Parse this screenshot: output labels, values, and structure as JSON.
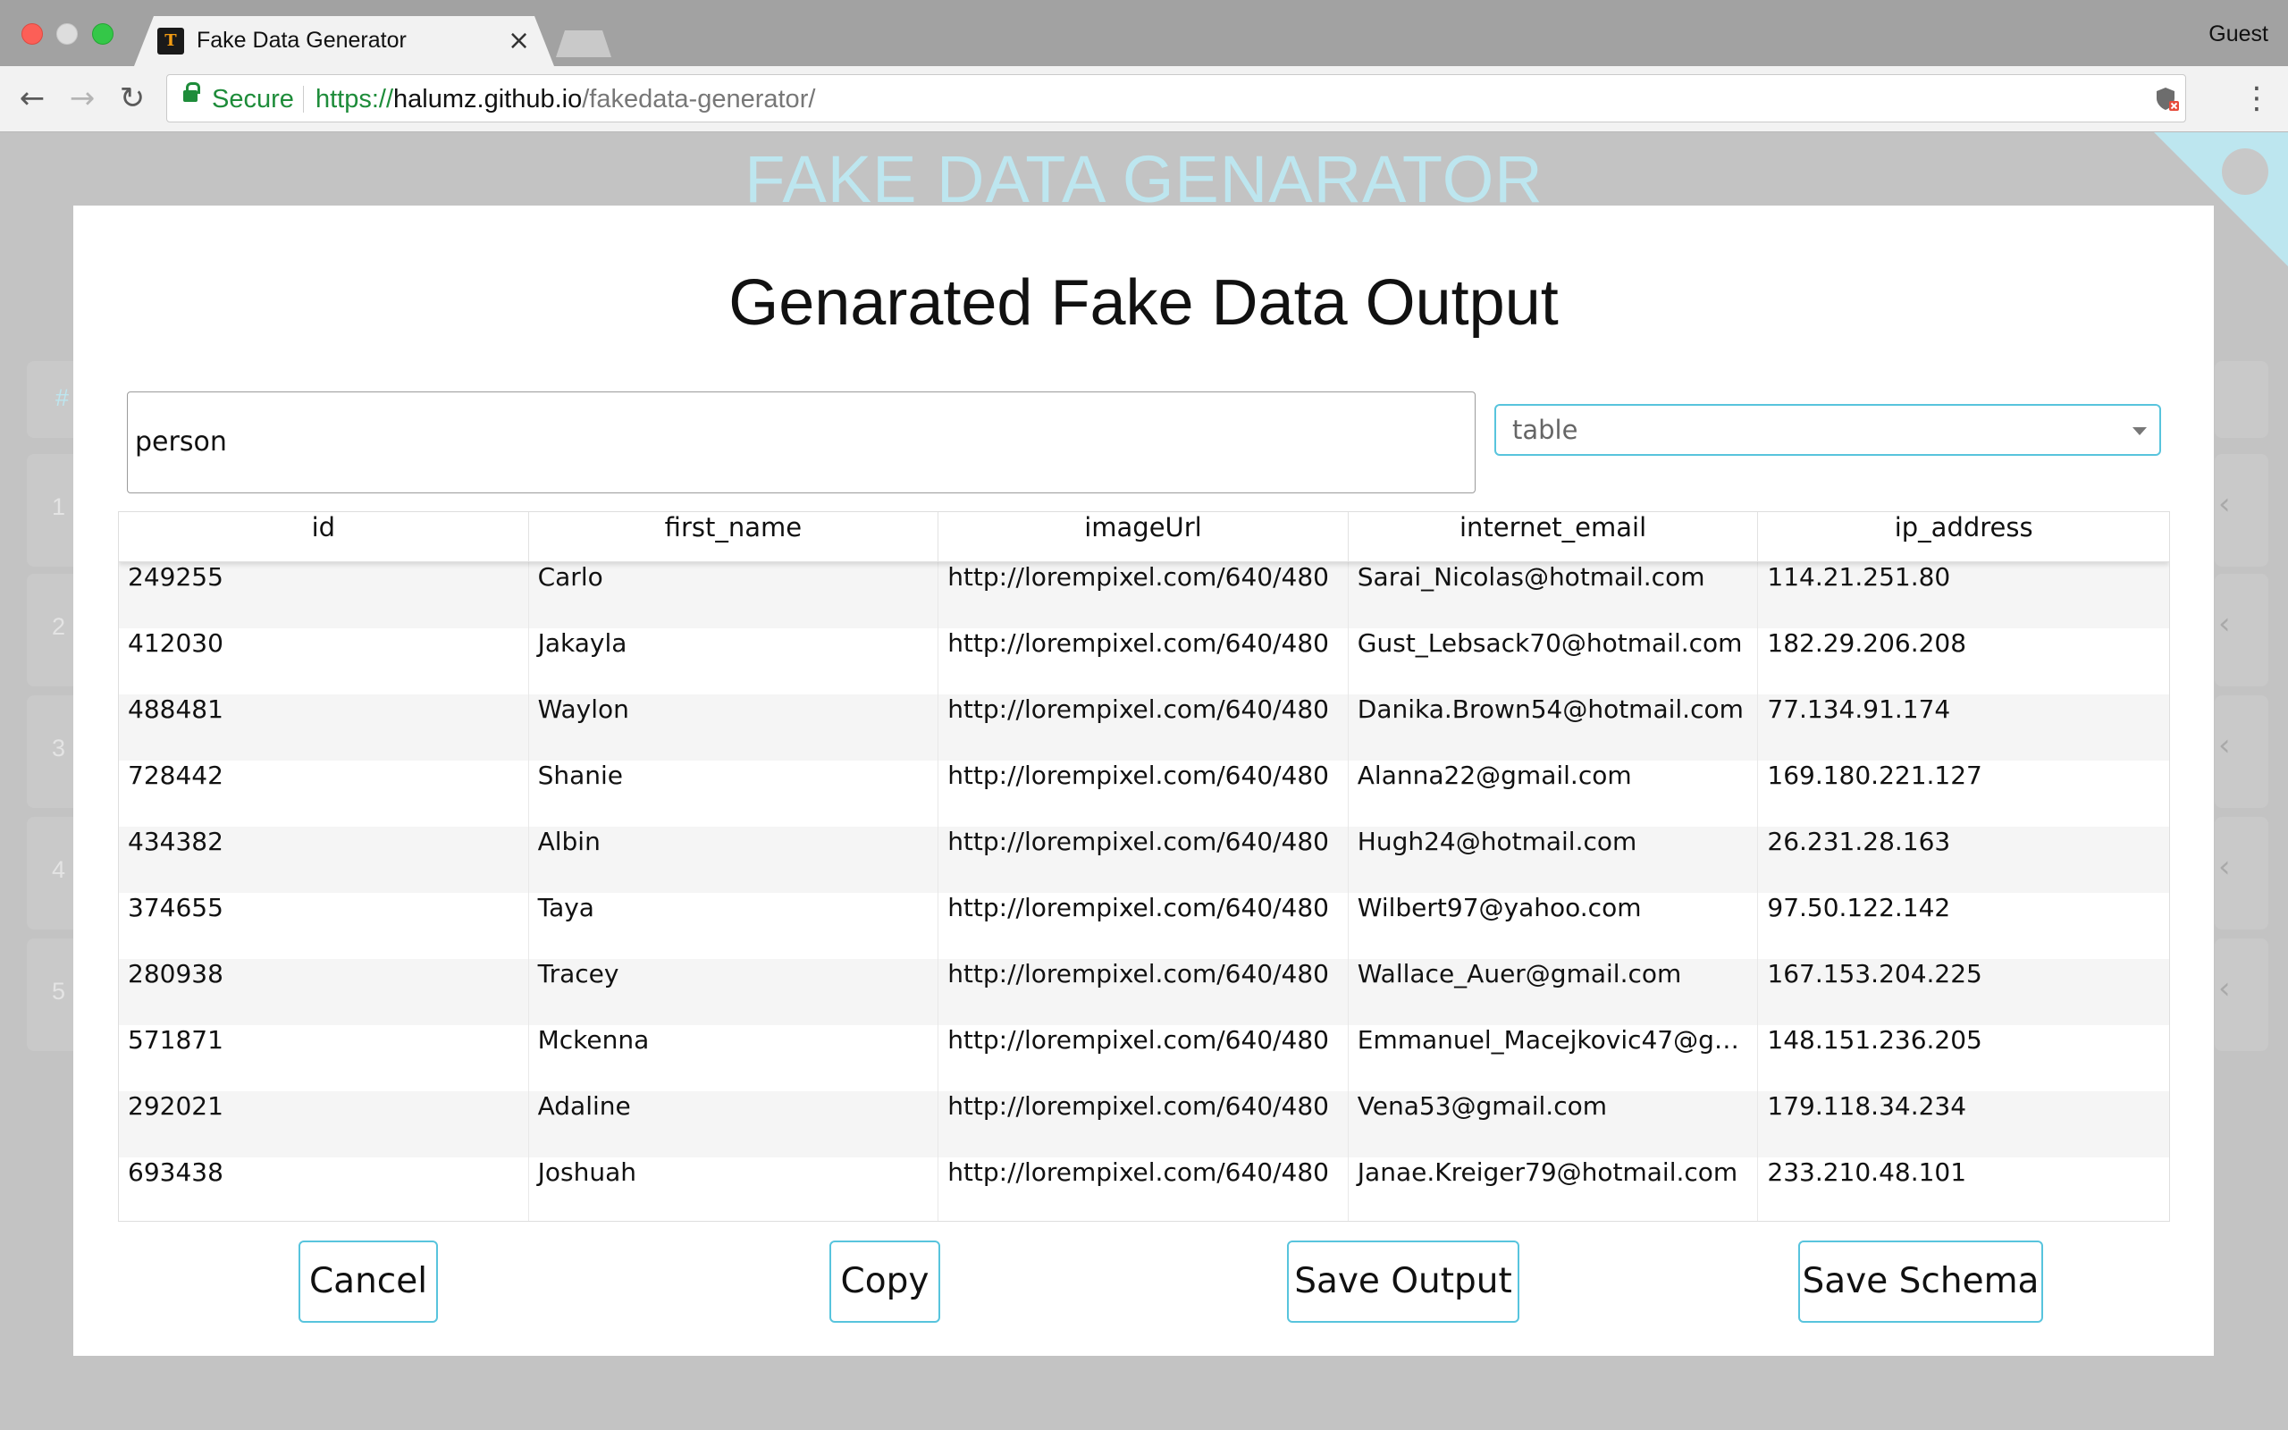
{
  "browser": {
    "tab_title": "Fake Data Generator",
    "tab_close": "×",
    "profile": "Guest",
    "nav": {
      "back": "←",
      "forward": "→",
      "reload": "↻"
    },
    "security_label": "Secure",
    "url": {
      "scheme": "https://",
      "host": "halumz.github.io",
      "path": "/fakedata-generator/"
    },
    "menu": "⋮"
  },
  "page": {
    "title": "FAKE DATA GENARATOR",
    "background_rows": [
      "1",
      "2",
      "3",
      "4",
      "5"
    ],
    "background_header_hash": "#"
  },
  "modal": {
    "title": "Genarated Fake Data Output",
    "name_input_value": "person",
    "format_select_value": "table",
    "columns": [
      "id",
      "first_name",
      "imageUrl",
      "internet_email",
      "ip_address"
    ],
    "rows": [
      [
        "249255",
        "Carlo",
        "http://lorempixel.com/640/480",
        "Sarai_Nicolas@hotmail.com",
        "114.21.251.80"
      ],
      [
        "412030",
        "Jakayla",
        "http://lorempixel.com/640/480",
        "Gust_Lebsack70@hotmail.com",
        "182.29.206.208"
      ],
      [
        "488481",
        "Waylon",
        "http://lorempixel.com/640/480",
        "Danika.Brown54@hotmail.com",
        "77.134.91.174"
      ],
      [
        "728442",
        "Shanie",
        "http://lorempixel.com/640/480",
        "Alanna22@gmail.com",
        "169.180.221.127"
      ],
      [
        "434382",
        "Albin",
        "http://lorempixel.com/640/480",
        "Hugh24@hotmail.com",
        "26.231.28.163"
      ],
      [
        "374655",
        "Taya",
        "http://lorempixel.com/640/480",
        "Wilbert97@yahoo.com",
        "97.50.122.142"
      ],
      [
        "280938",
        "Tracey",
        "http://lorempixel.com/640/480",
        "Wallace_Auer@gmail.com",
        "167.153.204.225"
      ],
      [
        "571871",
        "Mckenna",
        "http://lorempixel.com/640/480",
        "Emmanuel_Macejkovic47@gm...",
        "148.151.236.205"
      ],
      [
        "292021",
        "Adaline",
        "http://lorempixel.com/640/480",
        "Vena53@gmail.com",
        "179.118.34.234"
      ],
      [
        "693438",
        "Joshuah",
        "http://lorempixel.com/640/480",
        "Janae.Kreiger79@hotmail.com",
        "233.210.48.101"
      ]
    ],
    "buttons": {
      "cancel": "Cancel",
      "copy": "Copy",
      "save_output": "Save Output",
      "save_schema": "Save Schema"
    }
  },
  "colors": {
    "accent": "#58c4dd",
    "secure_green": "#1e8c3a",
    "page_title": "#bde6ef"
  }
}
